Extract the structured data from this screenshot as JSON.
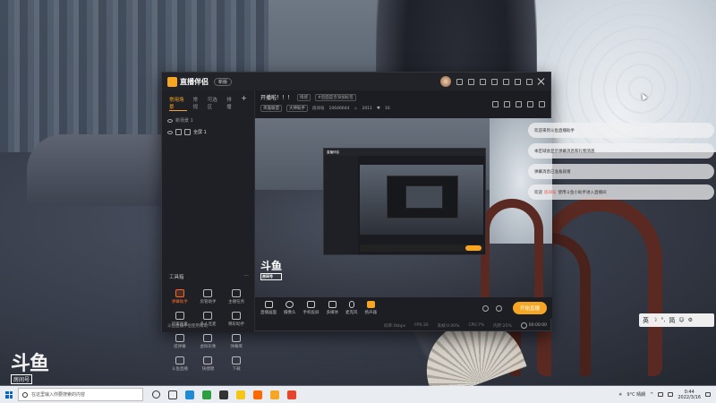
{
  "desktop": {
    "watermark": {
      "logo": "斗鱼",
      "sub": "房间号",
      "room": "10646644"
    }
  },
  "app": {
    "title": "直播伴侣",
    "version": "新版",
    "left_tabs": [
      "常用场景",
      "常规",
      "可选区",
      "排播"
    ],
    "scenes": [
      "新场景 1",
      "全屏 1"
    ],
    "toolbox_label": "工具箱",
    "tools": [
      "弹幕助手",
      "房管助手",
      "主播任务",
      "玩家连麦",
      "多人连麦",
      "精彩助手",
      "提弹幕",
      "虚拟形象",
      "弹幕库",
      "斗鱼直播",
      "快捷键",
      "下载"
    ],
    "ad_text": "斗鱼直播伴侣使用帮助",
    "stream": {
      "title": "开播啦！！！",
      "tags": [
        "情感",
        "#后面是否添加标签"
      ],
      "category": "英雄联盟",
      "rank_tag": "大神助手",
      "room_label": "房间号",
      "room_id": "10646644",
      "viewers": "2011",
      "followers": "16"
    },
    "controls": [
      "直播画面",
      "摄像头",
      "手机投屏",
      "多媒体",
      "麦克风",
      "扬声器"
    ],
    "start_button": "开始直播",
    "status": [
      "码率:0kbps",
      "FPS:30",
      "丢帧:0.00%",
      "CPU:7%",
      "内存:25%"
    ],
    "timer": "00:00:00"
  },
  "chat": [
    {
      "text": "欢迎来到斗鱼直播助手"
    },
    {
      "text": "本区域会显示弹幕消息和礼物消息"
    },
    {
      "text": "弹幕消息已准备就绪"
    },
    {
      "prefix": "欢迎",
      "name": "房间号",
      "suffix": "使用斗鱼小助手进入直播间"
    }
  ],
  "ime": {
    "mode": "英",
    "moon": "☽",
    "punct": "°,",
    "script": "简",
    "emoji": "☺",
    "gear": "⚙"
  },
  "taskbar": {
    "search_placeholder": "在这里输入你要搜索的内容",
    "weather": "9°C 晴朗",
    "time": "0:44",
    "date": "2022/3/16"
  },
  "colors": {
    "accent": "#f5a623",
    "danger": "#f56a2a",
    "taskbar": "#e9edf2"
  }
}
